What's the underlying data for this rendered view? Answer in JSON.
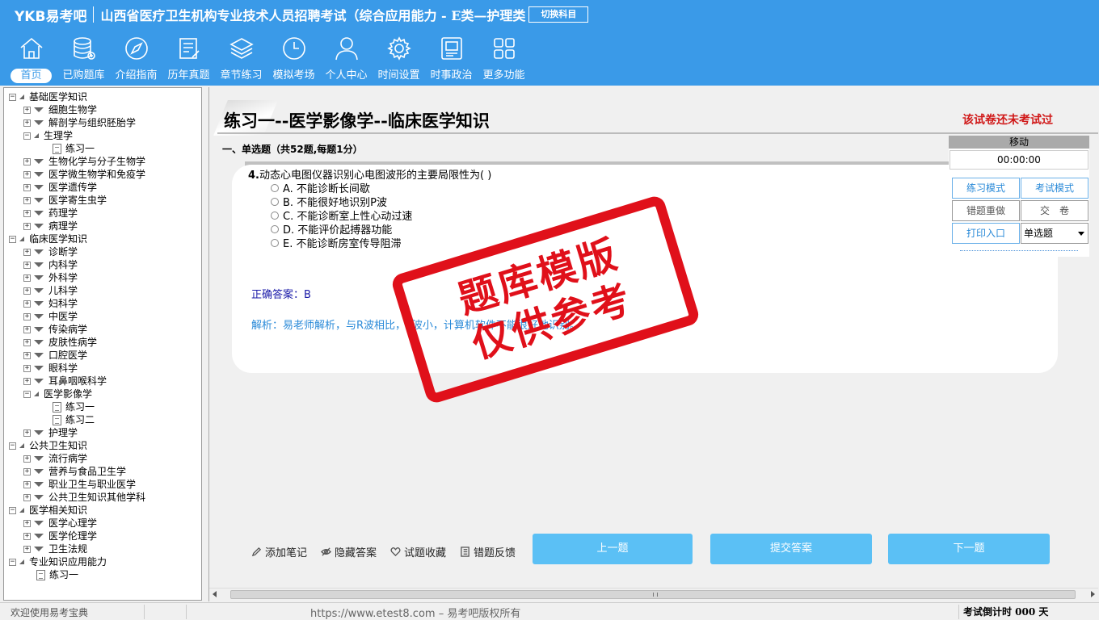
{
  "header": {
    "logo": "YKB易考吧",
    "title": "山西省医疗卫生机构专业技术人员招聘考试（综合应用能力 - E类—护理类",
    "switch_label": "切换科目"
  },
  "toolbar": [
    {
      "label": "首页",
      "icon": "home-icon",
      "active": true
    },
    {
      "label": "已购题库",
      "icon": "database-icon"
    },
    {
      "label": "介绍指南",
      "icon": "compass-icon"
    },
    {
      "label": "历年真题",
      "icon": "edit-list-icon"
    },
    {
      "label": "章节练习",
      "icon": "layers-icon"
    },
    {
      "label": "模拟考场",
      "icon": "clock-icon"
    },
    {
      "label": "个人中心",
      "icon": "user-icon"
    },
    {
      "label": "时间设置",
      "icon": "gear-icon"
    },
    {
      "label": "时事政治",
      "icon": "news-icon"
    },
    {
      "label": "更多功能",
      "icon": "grid-icon"
    }
  ],
  "tree": [
    {
      "label": "基础医学知识",
      "level": 0,
      "expanded": true
    },
    {
      "label": "细胞生物学",
      "level": 1,
      "expanded": false
    },
    {
      "label": "解剖学与组织胚胎学",
      "level": 1,
      "expanded": false
    },
    {
      "label": "生理学",
      "level": 1,
      "expanded": true
    },
    {
      "label": "练习一",
      "level": 2,
      "leaf": true
    },
    {
      "label": "生物化学与分子生物学",
      "level": 1,
      "expanded": false
    },
    {
      "label": "医学微生物学和免疫学",
      "level": 1,
      "expanded": false
    },
    {
      "label": "医学遗传学",
      "level": 1,
      "expanded": false
    },
    {
      "label": "医学寄生虫学",
      "level": 1,
      "expanded": false
    },
    {
      "label": "药理学",
      "level": 1,
      "expanded": false
    },
    {
      "label": "病理学",
      "level": 1,
      "expanded": false
    },
    {
      "label": "临床医学知识",
      "level": 0,
      "expanded": true
    },
    {
      "label": "诊断学",
      "level": 1,
      "expanded": false
    },
    {
      "label": "内科学",
      "level": 1,
      "expanded": false
    },
    {
      "label": "外科学",
      "level": 1,
      "expanded": false
    },
    {
      "label": "儿科学",
      "level": 1,
      "expanded": false
    },
    {
      "label": "妇科学",
      "level": 1,
      "expanded": false
    },
    {
      "label": "中医学",
      "level": 1,
      "expanded": false
    },
    {
      "label": "传染病学",
      "level": 1,
      "expanded": false
    },
    {
      "label": "皮肤性病学",
      "level": 1,
      "expanded": false
    },
    {
      "label": "口腔医学",
      "level": 1,
      "expanded": false
    },
    {
      "label": "眼科学",
      "level": 1,
      "expanded": false
    },
    {
      "label": "耳鼻咽喉科学",
      "level": 1,
      "expanded": false
    },
    {
      "label": "医学影像学",
      "level": 1,
      "expanded": true
    },
    {
      "label": "练习一",
      "level": 2,
      "leaf": true
    },
    {
      "label": "练习二",
      "level": 2,
      "leaf": true
    },
    {
      "label": "护理学",
      "level": 1,
      "expanded": false
    },
    {
      "label": "公共卫生知识",
      "level": 0,
      "expanded": true
    },
    {
      "label": "流行病学",
      "level": 1,
      "expanded": false
    },
    {
      "label": "营养与食品卫生学",
      "level": 1,
      "expanded": false
    },
    {
      "label": "职业卫生与职业医学",
      "level": 1,
      "expanded": false
    },
    {
      "label": "公共卫生知识其他学科",
      "level": 1,
      "expanded": false
    },
    {
      "label": "医学相关知识",
      "level": 0,
      "expanded": true
    },
    {
      "label": "医学心理学",
      "level": 1,
      "expanded": false
    },
    {
      "label": "医学伦理学",
      "level": 1,
      "expanded": false
    },
    {
      "label": "卫生法规",
      "level": 1,
      "expanded": false
    },
    {
      "label": "专业知识应用能力",
      "level": 0,
      "expanded": true
    },
    {
      "label": "练习一",
      "level": 1,
      "leaf": true
    }
  ],
  "paper": {
    "title": "练习一--医学影像学--临床医学知识",
    "status": "该试卷还未考试过",
    "section": "一、单选题（共52题,每题1分）"
  },
  "question": {
    "number": "4.",
    "text": "动态心电图仪器识别心电图波形的主要局限性为( )",
    "options": [
      "A. 不能诊断长间歇",
      "B. 不能很好地识别P波",
      "C. 不能诊断室上性心动过速",
      "D. 不能评价起搏器功能",
      "E. 不能诊断房室传导阻滞"
    ],
    "answer": "正确答案：B",
    "analysis": "解析：易老师解析，与R波相比，P波小，计算机软件不能很好地识别。"
  },
  "stamp": {
    "line1": "题库模版",
    "line2": "仅供参考"
  },
  "control": {
    "move_label": "移动",
    "timer": "00:00:00",
    "practice_mode": "练习模式",
    "exam_mode": "考试模式",
    "redo_wrong": "错题重做",
    "submit_paper": "交　卷",
    "print": "打印入口",
    "type_select": "单选题"
  },
  "actions": {
    "add_note": "添加笔记",
    "hide_answer": "隐藏答案",
    "favorite": "试题收藏",
    "feedback": "错题反馈",
    "prev": "上一题",
    "submit": "提交答案",
    "next": "下一题"
  },
  "status": {
    "welcome": "欢迎使用易考宝典",
    "copyright": "https://www.etest8.com – 易考吧版权所有",
    "countdown": "考试倒计时 000 天"
  }
}
